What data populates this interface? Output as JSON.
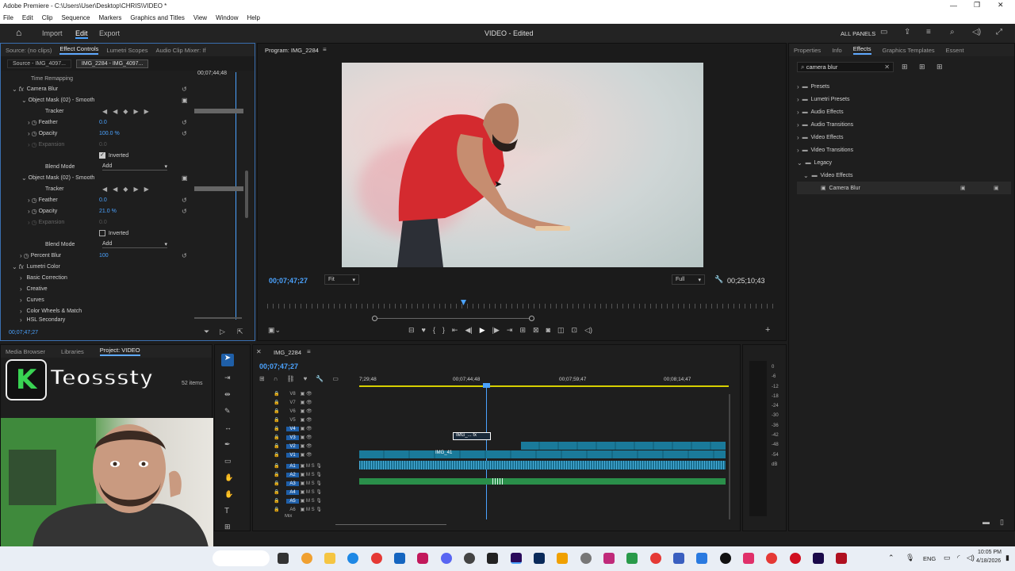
{
  "window": {
    "title": "Adobe Premiere - C:\\Users\\User\\Desktop\\CHRIS\\VIDEO *"
  },
  "menu": [
    "File",
    "Edit",
    "Clip",
    "Sequence",
    "Markers",
    "Graphics and Titles",
    "View",
    "Window",
    "Help"
  ],
  "appbar": {
    "import": "Import",
    "edit": "Edit",
    "export": "Export",
    "project_title": "VIDEO - Edited",
    "all_panels": "ALL PANELS"
  },
  "effect_controls": {
    "tabs": [
      "Source: (no clips)",
      "Effect Controls",
      "Lumetri Scopes",
      "Audio Clip Mixer: If"
    ],
    "source_clip": "Source - IMG_4097...",
    "seq_clip": "IMG_2284 - IMG_4097...",
    "mini_tc": "00;07;44;48",
    "rows": [
      {
        "label": "Time Remapping",
        "value": ""
      },
      {
        "label": "Camera Blur",
        "value": ""
      },
      {
        "label": "Object Mask (02) - Smooth",
        "value": ""
      },
      {
        "label": "Tracker",
        "value": ""
      },
      {
        "label": "Feather",
        "value": "0.0"
      },
      {
        "label": "Opacity",
        "value": "100.0 %"
      },
      {
        "label": "Expansion",
        "value": "0.0"
      },
      {
        "label": "Inverted",
        "value": ""
      },
      {
        "label": "Blend Mode",
        "value": "Add"
      },
      {
        "label": "Object Mask (02) - Smooth",
        "value": ""
      },
      {
        "label": "Tracker",
        "value": ""
      },
      {
        "label": "Feather",
        "value": "0.0"
      },
      {
        "label": "Opacity",
        "value": "21.0 %"
      },
      {
        "label": "Expansion",
        "value": "0.0"
      },
      {
        "label": "Inverted",
        "value": ""
      },
      {
        "label": "Blend Mode",
        "value": "Add"
      },
      {
        "label": "Percent Blur",
        "value": "100"
      },
      {
        "label": "Lumetri Color",
        "value": ""
      },
      {
        "label": "Basic Correction",
        "value": ""
      },
      {
        "label": "Creative",
        "value": ""
      },
      {
        "label": "Curves",
        "value": ""
      },
      {
        "label": "Color Wheels & Match",
        "value": ""
      },
      {
        "label": "HSL Secondary",
        "value": ""
      }
    ],
    "footer_tc": "00;07;47;27"
  },
  "program": {
    "title": "Program: IMG_2284",
    "timecode": "00;07;47;27",
    "fit": "Fit",
    "quality": "Full",
    "duration": "00;25;10;43"
  },
  "effects": {
    "tabs": [
      "Properties",
      "Info",
      "Effects",
      "Graphics Templates",
      "Essent"
    ],
    "search": "camera blur",
    "tree": [
      "Presets",
      "Lumetri Presets",
      "Audio Effects",
      "Audio Transitions",
      "Video Effects",
      "Video Transitions",
      "Legacy",
      "Video Effects",
      "Camera Blur"
    ]
  },
  "project": {
    "tabs": [
      "Media Browser",
      "Libraries",
      "Project: VIDEO"
    ],
    "items": "52 items",
    "logo_letter": "K",
    "logo_name": "Teosssty"
  },
  "timeline": {
    "title": "IMG_2284",
    "timecode": "00;07;47;27",
    "ruler": [
      "7;29;48",
      "00;07;44;48",
      "00;07;59;47",
      "00;08;14;47"
    ],
    "tracks": [
      "V8",
      "V7",
      "V6",
      "V5",
      "V4",
      "V3",
      "V2",
      "V1",
      "A1",
      "A2",
      "A3",
      "A4",
      "A5",
      "A6",
      "Mix"
    ],
    "clip_v3": "IMG_... fx",
    "clip_v1": "IMG_41",
    "meter": [
      "0",
      "-6",
      "-12",
      "-18",
      "-24",
      "-30",
      "-36",
      "-42",
      "-48",
      "-54",
      "dB"
    ]
  },
  "taskbar": {
    "lang": "ENG",
    "time": "10:05 PM",
    "date": "4/18/2026"
  },
  "colors": {
    "accent": "#4ba3ff",
    "video_clip": "#1a7a9a",
    "audio_clip": "#2a8f4a",
    "playhead": "#4ba3ff",
    "work_area": "#d7d000"
  }
}
